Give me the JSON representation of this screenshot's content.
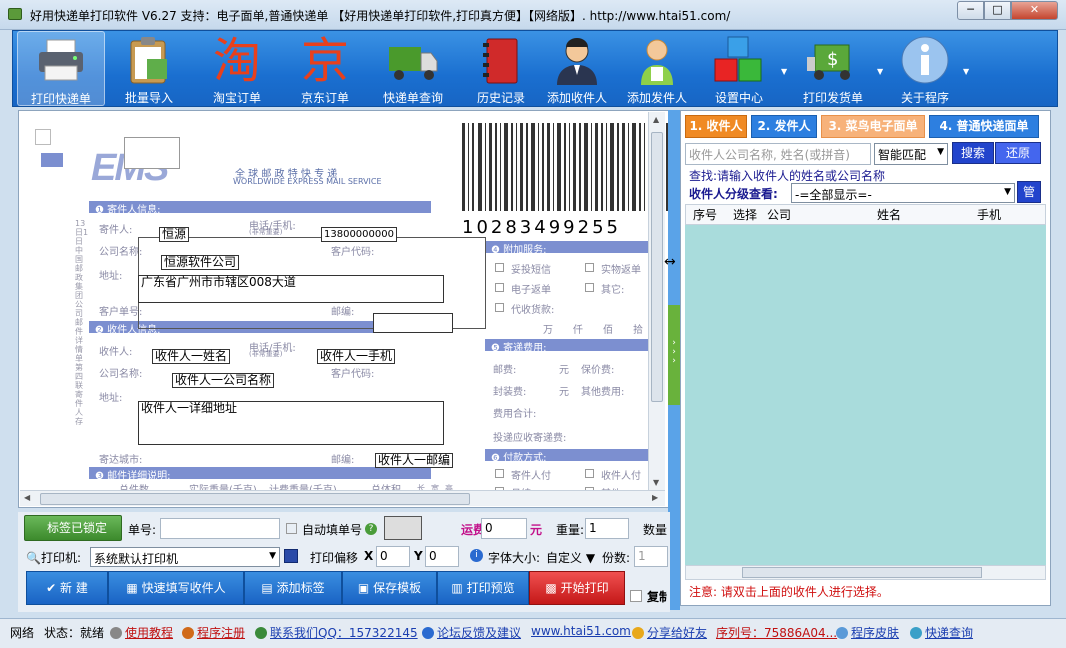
{
  "title": "好用快递单打印软件 V6.27  支持：电子面单,普通快递单 【好用快递单打印软件,打印真方便】【网络版】.  http://www.htai51.com/",
  "window": {
    "min": "─",
    "max": "□",
    "close": "✕"
  },
  "toolbar": [
    {
      "label": "打印快递单",
      "icon": "printer-icon"
    },
    {
      "label": "批量导入",
      "icon": "clipboard-import-icon"
    },
    {
      "label": "淘宝订单",
      "icon": "taobao-icon",
      "glyph": "淘"
    },
    {
      "label": "京东订单",
      "icon": "jd-icon",
      "glyph": "京"
    },
    {
      "label": "快递单查询",
      "icon": "truck-icon"
    },
    {
      "label": "历史记录",
      "icon": "notebook-icon"
    },
    {
      "label": "添加收件人",
      "icon": "person-suit-icon"
    },
    {
      "label": "添加发件人",
      "icon": "person-green-icon"
    },
    {
      "label": "设置中心",
      "icon": "cubes-icon"
    },
    {
      "label": "打印发货单",
      "icon": "money-truck-icon"
    },
    {
      "label": "关于程序",
      "icon": "info-icon"
    }
  ],
  "form": {
    "brand": "EMS",
    "brand_sub_cn": "全 球 邮 政 特 快 专 递",
    "brand_sub_en": "WORLDWIDE EXPRESS MAIL SERVICE",
    "barcode_digits": "10283499255",
    "sender_header": "❶ 寄件人信息:",
    "sender_label": "寄件人:",
    "phone_label": "电话/手机:",
    "phone_note": "(非常重要)",
    "company_label": "公司名称:",
    "customer_code": "客户代码:",
    "address_label": "地址:",
    "customer_no": "客户单号:",
    "postcode_label": "邮编:",
    "receiver_header": "❷ 收件人信息:",
    "receiver_label": "收件人:",
    "dest_city": "寄达城市:",
    "items_header": "❸ 邮件详细说明:",
    "items_cols": [
      "总件数",
      "实际重量(千克)",
      "计费重量(千克)",
      "总体积",
      "长",
      "宽",
      "高"
    ],
    "extra_header": "❹ 附加服务:",
    "services": [
      "妥投短信",
      "实物返单",
      "电子返单",
      "其它:",
      "代收货款:"
    ],
    "amount_units": [
      "万",
      "仟",
      "佰",
      "拾"
    ],
    "fee_header": "❺ 寄递费用:",
    "fee_rows": [
      "邮费:",
      "元",
      "保价费:",
      "封装费:",
      "元",
      "其他费用:",
      "费用合计:",
      "投递应收寄递费:"
    ],
    "pay_header": "❻ 付款方式:",
    "pay_options": [
      "寄件人付",
      "收件人付",
      "月结",
      "其他"
    ],
    "left_margin_text": "13日1日 中国邮政集团公司 邮件详情单 第四联 寄件人存"
  },
  "fields": {
    "sender_name": "恒源",
    "sender_phone": "13800000000",
    "sender_company": "恒源软件公司",
    "sender_address": "广东省广州市市辖区008大道",
    "recv_name": "收件人一姓名",
    "recv_phone": "收件人一手机",
    "recv_company": "收件人一公司名称",
    "recv_address": "收件人一详细地址",
    "recv_postcode": "收件人一邮编"
  },
  "right": {
    "tabs": [
      "1. 收件人",
      "2. 发件人",
      "3. 菜鸟电子面单",
      "4. 普通快递面单"
    ],
    "search_placeholder": "收件人公司名称, 姓名(或拼音)",
    "match_mode": "智能匹配",
    "search_btn": "搜索",
    "reset_btn": "还原",
    "hint": "查找:请输入收件人的姓名或公司名称",
    "group_label": "收件人分级查看:",
    "group_value": "-=全部显示=-",
    "manage_btn": "管",
    "columns": [
      "序号",
      "选择",
      "公司",
      "姓名",
      "手机"
    ],
    "note": "注意: 请双击上面的收件人进行选择。"
  },
  "bottom": {
    "lock_btn": "标签已锁定",
    "waybill_label": "单号:",
    "auto_fill": "自动填单号",
    "freight_label": "运费:￥",
    "freight_value": "0",
    "yuan": "元",
    "weight_label": "重量:",
    "weight_value": "1",
    "qty_label": "数量",
    "printer_label": "打印机:",
    "printer_value": "系统默认打印机",
    "offset_label": "打印偏移",
    "x_label": "X",
    "x_value": "0",
    "y_label": "Y",
    "y_value": "0",
    "font_label": "字体大小:",
    "font_value": "自定义",
    "copies_label": "份数:",
    "copies_value": "1",
    "copy_check": "复制"
  },
  "actions": [
    "新 建",
    "快速填写收件人",
    "添加标签",
    "保存模板",
    "打印预览",
    "开始打印"
  ],
  "status": {
    "network": "网络",
    "state": "状态：就绪",
    "tutorial": "使用教程",
    "register": "程序注册",
    "contact": "联系我们QQ：157322145",
    "forum": "论坛反馈及建议",
    "site": "www.htai51.com",
    "share": "分享给好友",
    "serial": "序列号：75886A04...",
    "skin": "程序皮肤",
    "track": "快递查询"
  },
  "colors": {
    "toolbar": "#1a6fd0",
    "accent_orange": "#f08a24",
    "list_bg": "#a9dcdc",
    "start_print": "#c41818"
  }
}
